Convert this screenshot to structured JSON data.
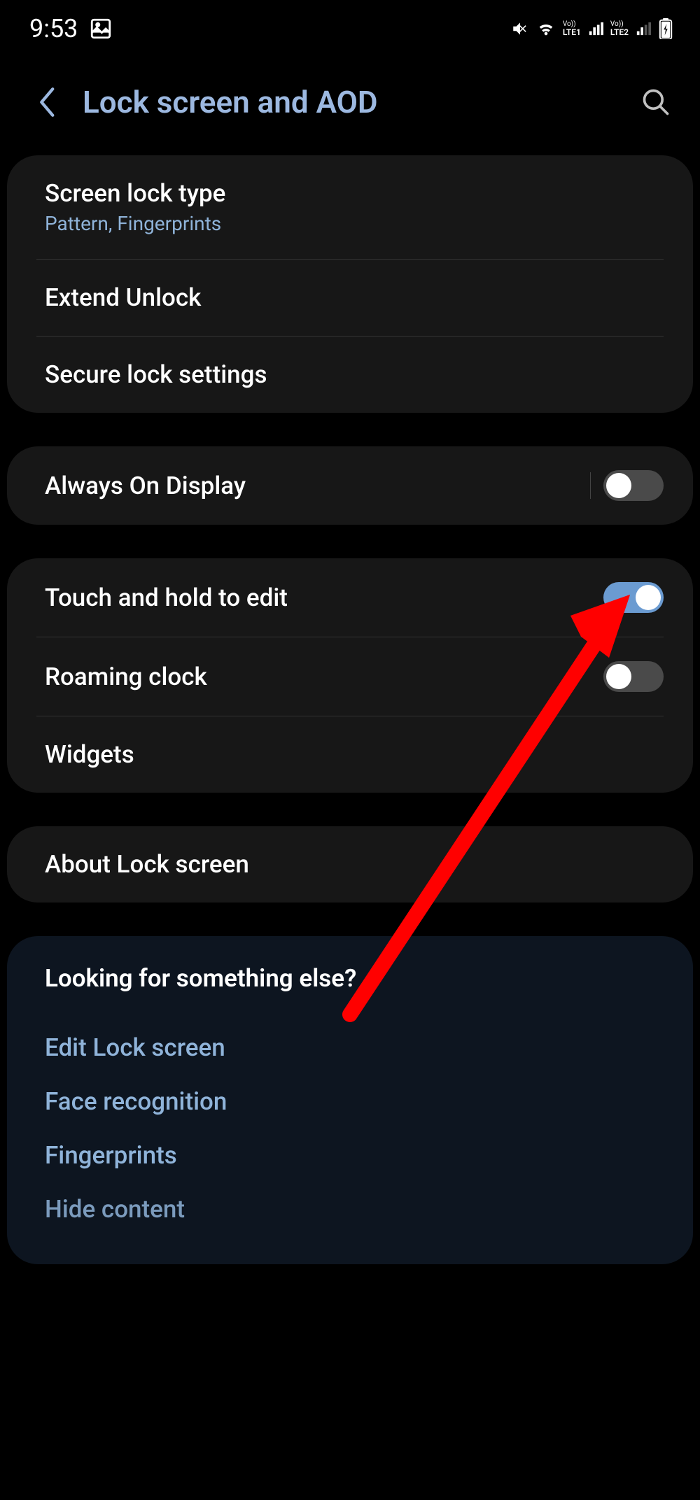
{
  "status_bar": {
    "time": "9:53",
    "sim1_label": "LTE1",
    "sim2_label": "LTE2",
    "vo_label": "Vo))"
  },
  "header": {
    "title": "Lock screen and AOD"
  },
  "card1": {
    "screen_lock_type": {
      "title": "Screen lock type",
      "subtitle": "Pattern, Fingerprints"
    },
    "extend_unlock": {
      "title": "Extend Unlock"
    },
    "secure_lock": {
      "title": "Secure lock settings"
    }
  },
  "card2": {
    "aod": {
      "title": "Always On Display",
      "enabled": false
    }
  },
  "card3": {
    "touch_hold": {
      "title": "Touch and hold to edit",
      "enabled": true
    },
    "roaming_clock": {
      "title": "Roaming clock",
      "enabled": false
    },
    "widgets": {
      "title": "Widgets"
    }
  },
  "card4": {
    "about": {
      "title": "About Lock screen"
    }
  },
  "looking_for": {
    "title": "Looking for something else?",
    "links": {
      "edit": "Edit Lock screen",
      "face": "Face recognition",
      "fingerprints": "Fingerprints",
      "hide": "Hide content"
    }
  }
}
